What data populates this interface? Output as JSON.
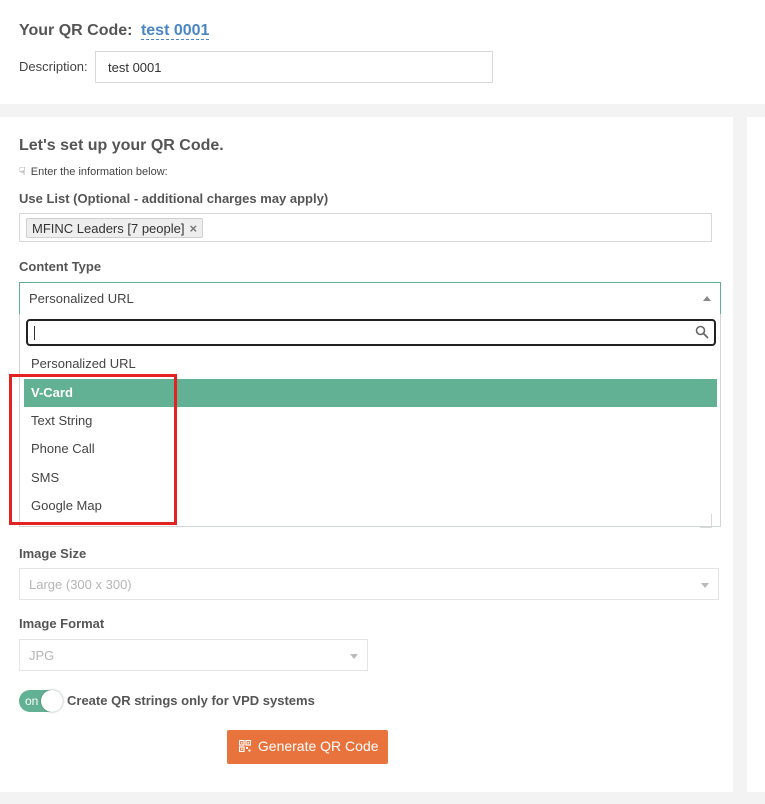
{
  "header": {
    "title_prefix": "Your QR Code:",
    "code_name": "test 0001",
    "description_label": "Description:",
    "description_value": "test 0001"
  },
  "setup": {
    "title": "Let's set up your QR Code.",
    "hint_icon": "pointing-hand-icon",
    "hint": "Enter the information below:"
  },
  "use_list": {
    "label": "Use List (Optional - additional charges may apply)",
    "tag": "MFINC Leaders [7 people]",
    "tag_remove": "×"
  },
  "content_type": {
    "label": "Content Type",
    "selected": "Personalized URL",
    "search_value": "",
    "options": [
      {
        "label": "Personalized URL",
        "highlighted": false
      },
      {
        "label": "V-Card",
        "highlighted": true
      },
      {
        "label": "Text String",
        "highlighted": false
      },
      {
        "label": "Phone Call",
        "highlighted": false
      },
      {
        "label": "SMS",
        "highlighted": false
      },
      {
        "label": "Google Map",
        "highlighted": false
      }
    ]
  },
  "image_size": {
    "label": "Image Size",
    "value": "Large (300 x 300)"
  },
  "image_format": {
    "label": "Image Format",
    "value": "JPG"
  },
  "vpd_toggle": {
    "state": "on",
    "label": "Create QR strings only for VPD systems"
  },
  "generate_button": {
    "icon": "qr-code-icon",
    "label": "Generate QR Code"
  },
  "colors": {
    "accent_green": "#62b195",
    "button_orange": "#e8733d",
    "annotation_red": "#e32222",
    "link_blue": "#4a86c5"
  }
}
